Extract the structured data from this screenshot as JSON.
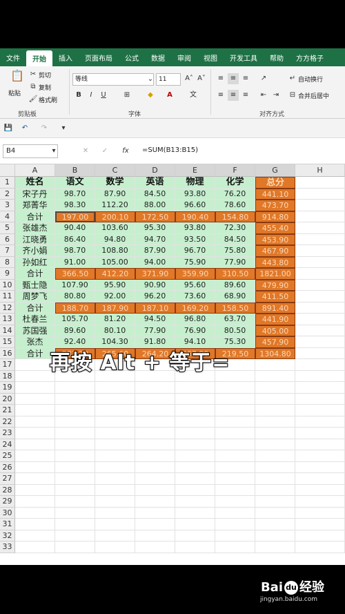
{
  "tabs": [
    "文件",
    "开始",
    "插入",
    "页面布局",
    "公式",
    "数据",
    "审阅",
    "视图",
    "开发工具",
    "帮助",
    "方方格子"
  ],
  "ribbon": {
    "paste": "粘贴",
    "cut": "剪切",
    "copy": "复制",
    "format_painter": "格式刷",
    "clipboard_group": "剪贴板",
    "font_name": "等线",
    "font_size": "11",
    "font_group": "字体",
    "wrap_text": "自动换行",
    "merge_center": "合并后居中",
    "align_group": "对齐方式"
  },
  "name_box": "B4",
  "formula": "=SUM(B13:B15)",
  "columns": [
    "A",
    "B",
    "C",
    "D",
    "E",
    "F",
    "G",
    "H"
  ],
  "rows": [
    "1",
    "2",
    "3",
    "4",
    "5",
    "6",
    "7",
    "8",
    "9",
    "10",
    "11",
    "12",
    "13",
    "14",
    "15",
    "16",
    "17",
    "18",
    "19",
    "20",
    "21",
    "22",
    "23",
    "24",
    "25",
    "26",
    "27",
    "28",
    "29",
    "30",
    "31",
    "32",
    "33"
  ],
  "table": {
    "header": [
      "姓名",
      "语文",
      "数学",
      "英语",
      "物理",
      "化学",
      "总分"
    ],
    "rows": [
      {
        "type": "data",
        "cells": [
          "宋子丹",
          "98.70",
          "87.90",
          "84.50",
          "93.80",
          "76.20",
          "441.10"
        ]
      },
      {
        "type": "data",
        "cells": [
          "郑菁华",
          "98.30",
          "112.20",
          "88.00",
          "96.60",
          "78.60",
          "473.70"
        ]
      },
      {
        "type": "total",
        "cells": [
          "合计",
          "197.00",
          "200.10",
          "172.50",
          "190.40",
          "154.80",
          "914.80"
        ]
      },
      {
        "type": "data",
        "cells": [
          "张雄杰",
          "90.40",
          "103.60",
          "95.30",
          "93.80",
          "72.30",
          "455.40"
        ]
      },
      {
        "type": "data",
        "cells": [
          "江晓勇",
          "86.40",
          "94.80",
          "94.70",
          "93.50",
          "84.50",
          "453.90"
        ]
      },
      {
        "type": "data",
        "cells": [
          "齐小娟",
          "98.70",
          "108.80",
          "87.90",
          "96.70",
          "75.80",
          "467.90"
        ]
      },
      {
        "type": "data",
        "cells": [
          "孙如红",
          "91.00",
          "105.00",
          "94.00",
          "75.90",
          "77.90",
          "443.80"
        ]
      },
      {
        "type": "total",
        "cells": [
          "合计",
          "366.50",
          "412.20",
          "371.90",
          "359.90",
          "310.50",
          "1821.00"
        ]
      },
      {
        "type": "data",
        "cells": [
          "甄士隐",
          "107.90",
          "95.90",
          "90.90",
          "95.60",
          "89.60",
          "479.90"
        ]
      },
      {
        "type": "data",
        "cells": [
          "周梦飞",
          "80.80",
          "92.00",
          "96.20",
          "73.60",
          "68.90",
          "411.50"
        ]
      },
      {
        "type": "total",
        "cells": [
          "合计",
          "188.70",
          "187.90",
          "187.10",
          "169.20",
          "158.50",
          "891.40"
        ]
      },
      {
        "type": "data",
        "cells": [
          "杜春兰",
          "105.70",
          "81.20",
          "94.50",
          "96.80",
          "63.70",
          "441.90"
        ]
      },
      {
        "type": "data",
        "cells": [
          "苏国强",
          "89.60",
          "80.10",
          "77.90",
          "76.90",
          "80.50",
          "405.00"
        ]
      },
      {
        "type": "data",
        "cells": [
          "张杰",
          "92.40",
          "104.30",
          "91.80",
          "94.10",
          "75.30",
          "457.90"
        ]
      },
      {
        "type": "total",
        "cells": [
          "合计",
          "287.70",
          "265.60",
          "264.20",
          "267.80",
          "219.50",
          "1304.80"
        ]
      }
    ]
  },
  "caption": "再按 Alt + 等于=",
  "watermark": {
    "brand": "Bai 经验",
    "site": "jingyan.baidu.com"
  },
  "colors": {
    "ribbon_green": "#1e7145",
    "cell_green": "#c6efce",
    "cell_orange": "#e07828"
  }
}
